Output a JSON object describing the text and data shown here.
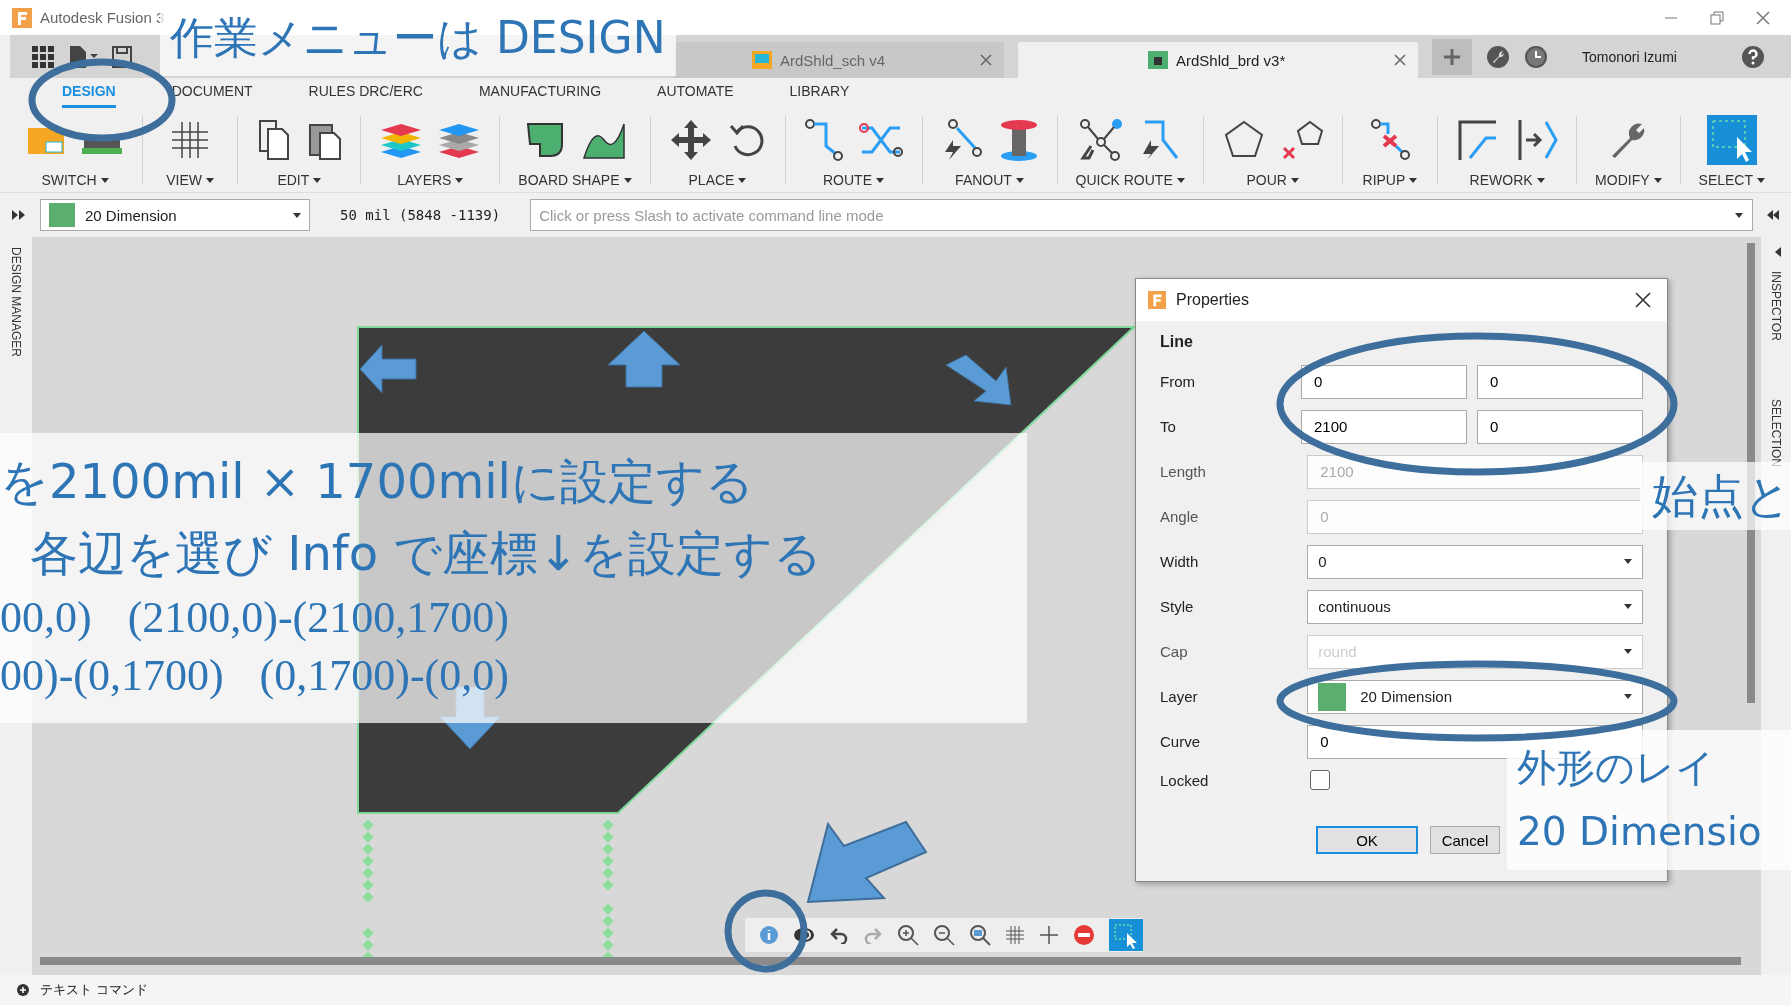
{
  "window": {
    "title": "Autodesk Fusion 3"
  },
  "doc_tabs": [
    {
      "label": "ArdShld_sch v4",
      "selected": false
    },
    {
      "label": "ArdShld_brd v3*",
      "selected": true
    }
  ],
  "user": "Tomonori Izumi",
  "menu_tabs": [
    {
      "label": "DESIGN",
      "selected": true
    },
    {
      "label": "DOCUMENT",
      "selected": false
    },
    {
      "label": "RULES DRC/ERC",
      "selected": false
    },
    {
      "label": "MANUFACTURING",
      "selected": false
    },
    {
      "label": "AUTOMATE",
      "selected": false
    },
    {
      "label": "LIBRARY",
      "selected": false
    }
  ],
  "toolbar_groups": [
    "SWITCH",
    "VIEW",
    "EDIT",
    "LAYERS",
    "BOARD SHAPE",
    "PLACE",
    "ROUTE",
    "FANOUT",
    "QUICK ROUTE",
    "POUR",
    "RIPUP",
    "REWORK",
    "MODIFY",
    "SELECT"
  ],
  "command_bar": {
    "layer": "20 Dimension",
    "readout": "50 mil (5848 -1139)",
    "placeholder": "Click or press Slash to activate command line mode"
  },
  "side_panels": {
    "left": "DESIGN MANAGER",
    "right": [
      "INSPECTOR",
      "SELECTION"
    ]
  },
  "dialog": {
    "title": "Properties",
    "section": "Line",
    "fields": [
      {
        "label": "From",
        "kind": "pair",
        "values": [
          "0",
          "0"
        ],
        "disabled": false
      },
      {
        "label": "To",
        "kind": "pair",
        "values": [
          "2100",
          "0"
        ],
        "disabled": false
      },
      {
        "label": "Length",
        "kind": "text",
        "value": "2100",
        "disabled": true
      },
      {
        "label": "Angle",
        "kind": "text",
        "value": "0",
        "disabled": true
      },
      {
        "label": "Width",
        "kind": "select",
        "value": "0",
        "disabled": false
      },
      {
        "label": "Style",
        "kind": "select",
        "value": "continuous",
        "disabled": false
      },
      {
        "label": "Cap",
        "kind": "select",
        "value": "round",
        "disabled": true
      },
      {
        "label": "Layer",
        "kind": "layer",
        "value": "20 Dimension",
        "disabled": false
      },
      {
        "label": "Curve",
        "kind": "text",
        "value": "0",
        "disabled": false
      },
      {
        "label": "Locked",
        "kind": "checkbox",
        "checked": false,
        "disabled": false
      }
    ],
    "buttons": [
      {
        "label": "OK",
        "default": true
      },
      {
        "label": "Cancel",
        "default": false
      }
    ]
  },
  "annotations": {
    "title": "作業メニューは DESIGN",
    "lines": [
      "を2100mil × 1700milに設定する",
      "各辺を選び Info で座標↓を設定する"
    ],
    "coords": [
      [
        "00,0)",
        "(2100,0)-(2100,1700)"
      ],
      [
        "00)-(0,1700)",
        "(0,1700)-(0,0)"
      ]
    ],
    "right_top": "始点と",
    "right_bottom": [
      "外形のレイ",
      "20 Dimensio"
    ]
  },
  "status_bar": "テキスト コマンド"
}
